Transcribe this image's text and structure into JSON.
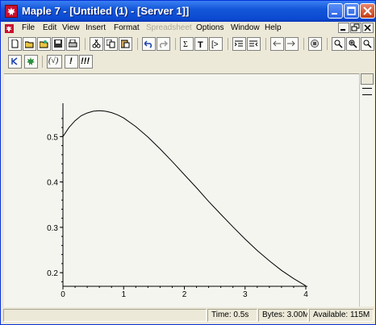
{
  "window": {
    "title": "Maple 7 - [Untitled (1) - [Server 1]]"
  },
  "menu": [
    {
      "label": "File"
    },
    {
      "label": "Edit"
    },
    {
      "label": "View"
    },
    {
      "label": "Insert"
    },
    {
      "label": "Format"
    },
    {
      "label": "Spreadsheet",
      "disabled": true
    },
    {
      "label": "Options"
    },
    {
      "label": "Window"
    },
    {
      "label": "Help"
    }
  ],
  "toolbar2": {
    "sqrt_label": "(√)",
    "exec_label": "!",
    "exec_all_label": "!!!"
  },
  "plot": {
    "chart_data": {
      "type": "line",
      "title": "",
      "xlabel": "",
      "ylabel": "",
      "xlim": [
        0,
        4
      ],
      "ylim": [
        0.17,
        0.57
      ],
      "xticks": [
        "0",
        "1",
        "2",
        "3",
        "4"
      ],
      "yticks": [
        "0.2",
        "0.3",
        "0.4",
        "0.5"
      ],
      "grid": false,
      "series": [
        {
          "x": [
            0,
            0.1,
            0.2,
            0.3,
            0.4,
            0.5,
            0.6,
            0.7,
            0.8,
            0.9,
            1.0,
            1.2,
            1.4,
            1.6,
            1.8,
            2.0,
            2.2,
            2.4,
            2.6,
            2.8,
            3.0,
            3.2,
            3.4,
            3.6,
            3.8,
            4.0
          ],
          "y": [
            0.5,
            0.52,
            0.535,
            0.546,
            0.552,
            0.556,
            0.557,
            0.556,
            0.553,
            0.548,
            0.541,
            0.522,
            0.499,
            0.473,
            0.445,
            0.416,
            0.387,
            0.357,
            0.329,
            0.301,
            0.274,
            0.249,
            0.226,
            0.205,
            0.187,
            0.171
          ]
        }
      ]
    }
  },
  "status": {
    "time": "Time: 0.5s",
    "bytes": "Bytes: 3.00M",
    "available": "Available: 115M"
  },
  "colors": {
    "titlebar": "#0a4bd2",
    "menu_disabled": "#aca899"
  }
}
